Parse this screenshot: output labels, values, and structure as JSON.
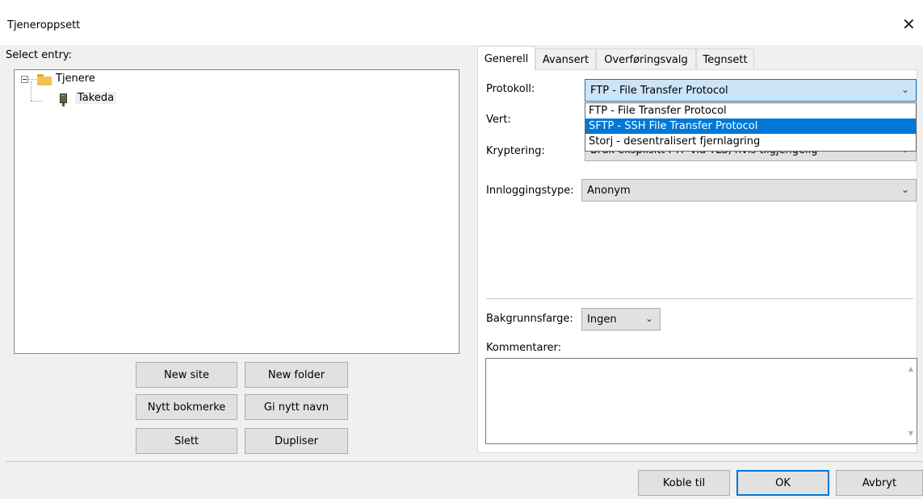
{
  "window": {
    "title": "Tjeneroppsett",
    "close_glyph": "✕"
  },
  "left": {
    "select_label": "Select entry:",
    "tree": {
      "root": {
        "label": "Tjenere",
        "expander": "⊟"
      },
      "child": {
        "label": "Takeda"
      }
    },
    "buttons": {
      "new_site": "New site",
      "new_folder": "New folder",
      "new_bookmark": "Nytt bokmerke",
      "rename": "Gi nytt navn",
      "delete": "Slett",
      "duplicate": "Dupliser"
    }
  },
  "tabs": [
    {
      "label": "Generell",
      "active": true
    },
    {
      "label": "Avansert",
      "active": false
    },
    {
      "label": "Overføringsvalg",
      "active": false
    },
    {
      "label": "Tegnsett",
      "active": false
    }
  ],
  "general": {
    "protocol_label": "Protokoll:",
    "protocol_value": "FTP - File Transfer Protocol",
    "protocol_options": [
      "FTP - File Transfer Protocol",
      "SFTP - SSH File Transfer Protocol",
      "Storj - desentralisert fjernlagring"
    ],
    "highlighted_option_index": 1,
    "host_label": "Vert:",
    "encryption_label": "Kryptering:",
    "encryption_value": "Bruk eksplisitt FTP via TLS, hvis tilgjengelig",
    "login_type_label": "Innloggingstype:",
    "login_type_value": "Anonym",
    "background_label": "Bakgrunnsfarge:",
    "background_value": "Ingen",
    "comments_label": "Kommentarer:",
    "comments_value": ""
  },
  "footer": {
    "connect": "Koble til",
    "ok": "OK",
    "cancel": "Avbryt"
  },
  "icons": {
    "folder": "folder-icon",
    "server": "server-icon",
    "chevron": "⌄",
    "scroll_up": "▲",
    "scroll_down": "▼"
  },
  "colors": {
    "accent": "#0078d7",
    "folder": "#f2c14e",
    "highlight_bg": "#cce4f7"
  }
}
